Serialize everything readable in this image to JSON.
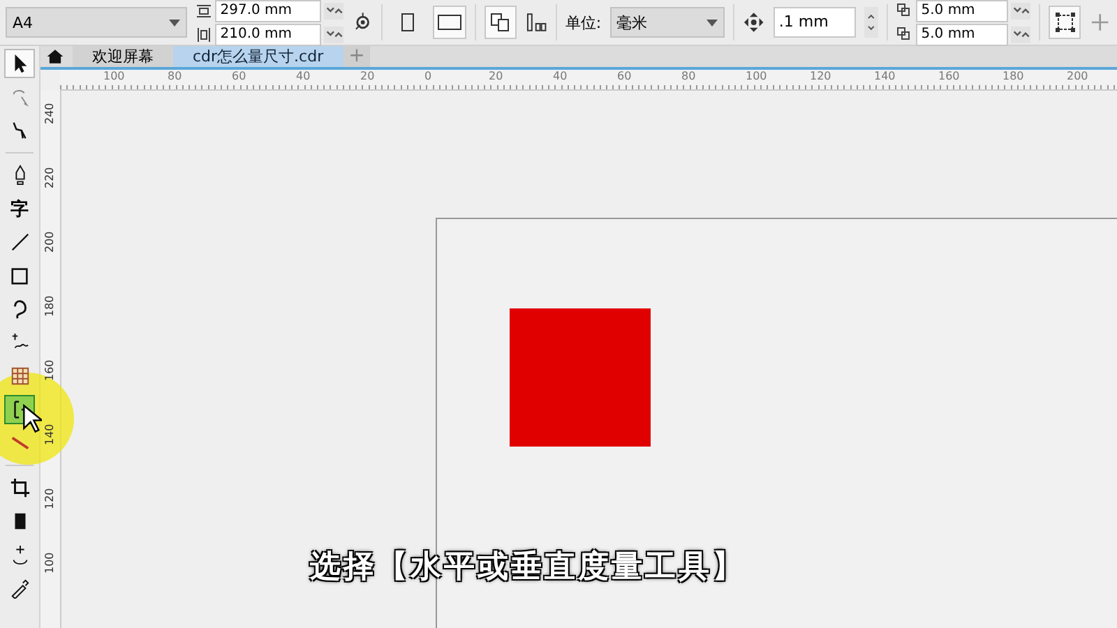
{
  "property_bar": {
    "page_size": "A4",
    "width": "297.0 mm",
    "height": "210.0 mm",
    "orientation_buttons": [
      {
        "kind": "portrait",
        "selected": false
      },
      {
        "kind": "landscape",
        "selected": true
      }
    ],
    "units_label": "单位:",
    "units": "毫米",
    "nudge": ".1 mm",
    "duplicate_x": "5.0 mm",
    "duplicate_y": "5.0 mm"
  },
  "tabs": [
    {
      "label": "欢迎屏幕",
      "selected": false
    },
    {
      "label": "cdr怎么量尺寸.cdr",
      "selected": true
    }
  ],
  "add_tab": "+",
  "toolbox": [
    {
      "kind": "pointer",
      "selected": true
    },
    {
      "kind": "freehand",
      "selected": false
    },
    {
      "kind": "shape",
      "selected": false
    },
    {
      "kind": "pen",
      "selected": false
    },
    {
      "kind": "text",
      "label": "字",
      "selected": false
    },
    {
      "kind": "line",
      "selected": false
    },
    {
      "kind": "rectangle",
      "selected": false
    },
    {
      "kind": "curve",
      "selected": false
    },
    {
      "kind": "blend",
      "selected": false
    },
    {
      "kind": "table",
      "selected": false
    },
    {
      "kind": "dimension",
      "selected": true
    },
    {
      "kind": "connector",
      "selected": false
    },
    {
      "kind": "crop",
      "selected": false
    },
    {
      "kind": "eraser",
      "selected": false
    },
    {
      "kind": "transform",
      "selected": false
    },
    {
      "kind": "eyedropper",
      "selected": false
    }
  ],
  "horizontal_ruler": [
    "100",
    "80",
    "60",
    "40",
    "20",
    "0",
    "20",
    "40",
    "60",
    "80",
    "100",
    "120",
    "140",
    "160",
    "180",
    "200"
  ],
  "vertical_ruler": [
    "240",
    "220",
    "200",
    "180",
    "160",
    "140",
    "120",
    "100"
  ],
  "caption": "选择【水平或垂直度量工具】"
}
